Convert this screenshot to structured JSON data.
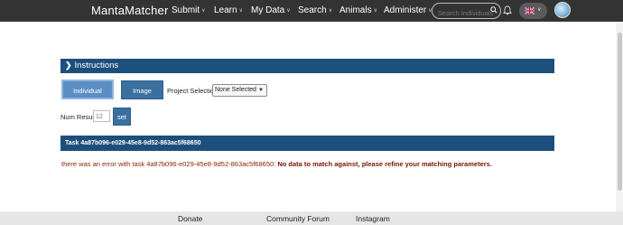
{
  "nav": {
    "brand": "MantaMatcher",
    "items": [
      {
        "label": "Submit",
        "has_dropdown": true
      },
      {
        "label": "Learn",
        "has_dropdown": true
      },
      {
        "label": "My Data",
        "has_dropdown": true
      },
      {
        "label": "Search",
        "has_dropdown": true
      },
      {
        "label": "Animals",
        "has_dropdown": true
      },
      {
        "label": "Administer",
        "has_dropdown": true
      }
    ],
    "search_placeholder": "Search Individuals",
    "icons": [
      "search-icon",
      "bell-icon",
      "uk-flag-icon",
      "chevron-down-icon"
    ],
    "background_color": "#333333"
  },
  "main": {
    "instructions_label": "Instructions",
    "buttons": {
      "individual_scores": "Individual Scores",
      "image_scores": "Image Scores",
      "set": "set"
    },
    "project_selection_label": "Project Selection",
    "project_selection_value": "None Selected",
    "num_results_label": "Num Results:",
    "num_results_placeholder": "12",
    "task_header": "Task 4a87b096-e029-45e8-9d52-863ac5f68650",
    "error_prefix": "there was an error with task 4a87b096-e029-45e8-9d52-863ac5f68650:",
    "error_message": "No data to match against, please refine your matching parameters.",
    "accent_color": "#1d4f7c"
  },
  "footer": {
    "links": [
      "Donate",
      "Community Forum",
      "Instagram"
    ]
  }
}
